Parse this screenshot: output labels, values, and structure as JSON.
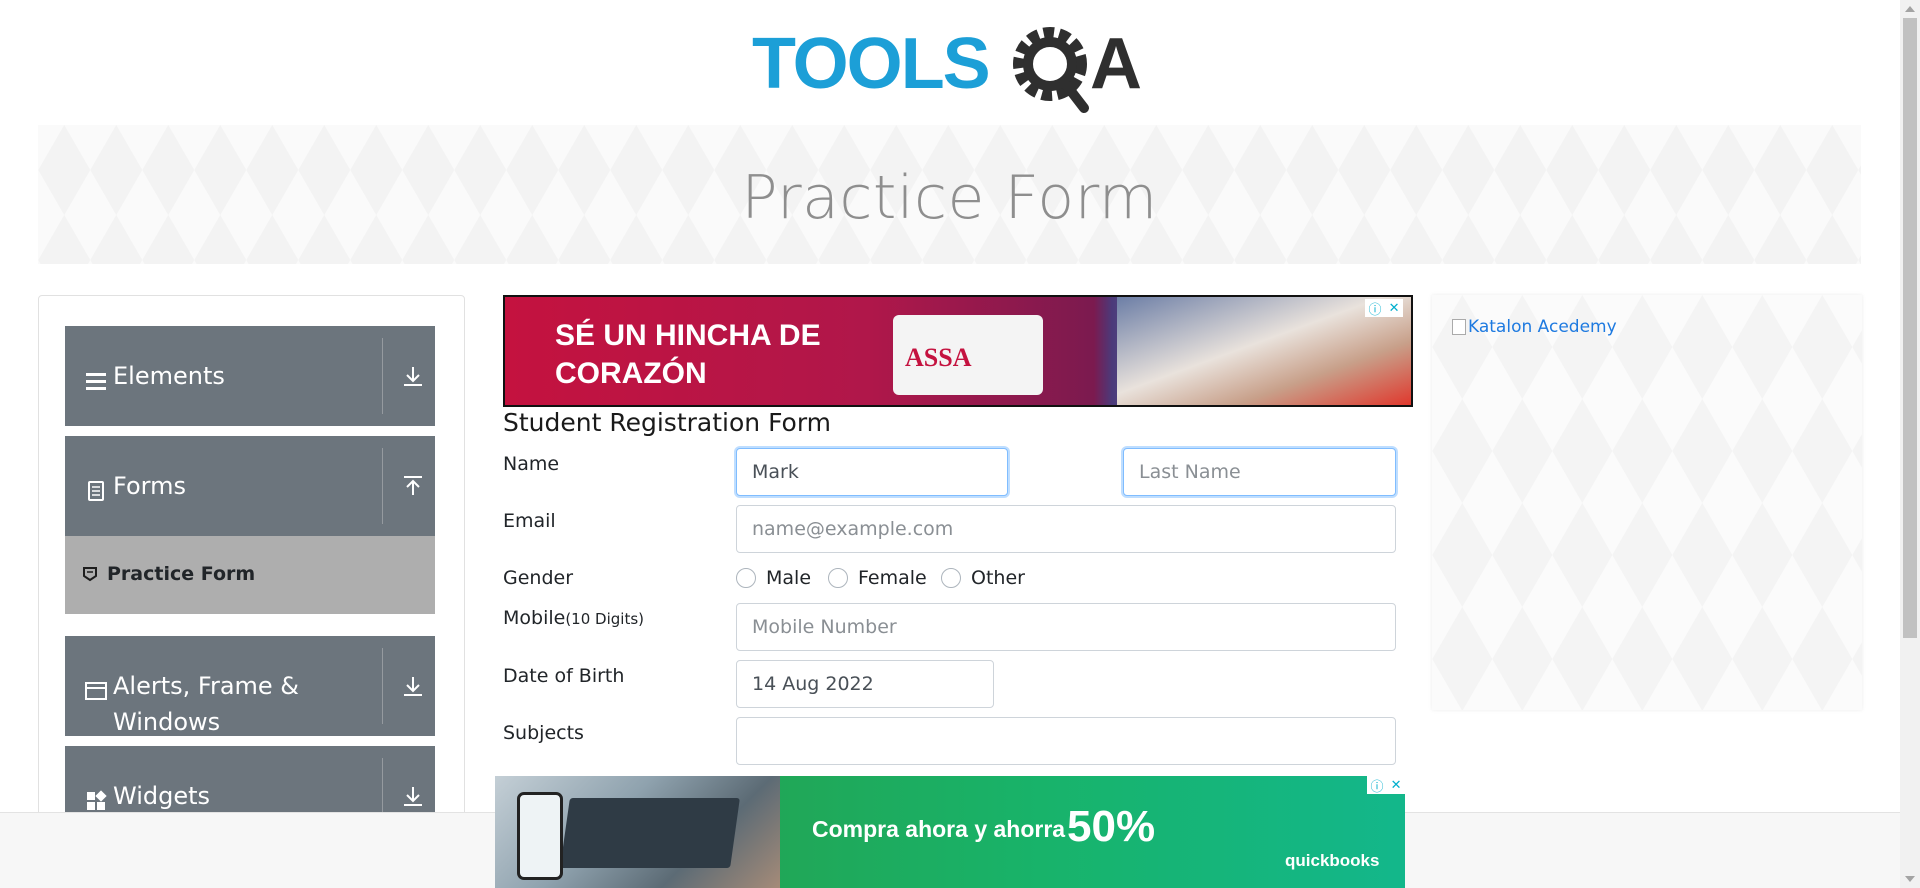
{
  "logo": {
    "text_left": "TOOLS",
    "text_right": "A",
    "alt": "TOOLSQA"
  },
  "banner": {
    "title": "Practice Form"
  },
  "sidebar": {
    "groups": [
      {
        "label": "Elements",
        "icon": "hamburger-icon",
        "arrow": "download-arrow-icon"
      },
      {
        "label": "Forms",
        "icon": "document-icon",
        "arrow": "upload-arrow-icon"
      },
      {
        "label": "Alerts, Frame & Windows",
        "icon": "window-icon",
        "arrow": "download-arrow-icon"
      },
      {
        "label": "Widgets",
        "icon": "widgets-icon",
        "arrow": "download-arrow-icon"
      }
    ],
    "active_item": {
      "label": "Practice Form",
      "icon": "form-icon"
    }
  },
  "ads": {
    "top": {
      "line1": "SÉ UN HINCHA DE",
      "line2": "CORAZÓN",
      "product": "ASSA"
    },
    "bottom": {
      "text": "Compra ahora y ahorra",
      "discount": "50%",
      "brand": "quickbooks"
    },
    "right": {
      "alt": "Katalon Acedemy"
    }
  },
  "form": {
    "title": "Student Registration Form",
    "name_label": "Name",
    "first_name_value": "Mark",
    "last_name_placeholder": "Last Name",
    "email_label": "Email",
    "email_placeholder": "name@example.com",
    "gender_label": "Gender",
    "gender_options": [
      "Male",
      "Female",
      "Other"
    ],
    "mobile_label": "Mobile",
    "mobile_hint": "(10 Digits)",
    "mobile_placeholder": "Mobile Number",
    "dob_label": "Date of Birth",
    "dob_value": "14 Aug 2022",
    "subjects_label": "Subjects"
  },
  "colors": {
    "sidebar_group": "#6c757d",
    "active_item": "#aeaeae",
    "logo_blue": "#1c9fd7",
    "logo_dark": "#333333"
  }
}
